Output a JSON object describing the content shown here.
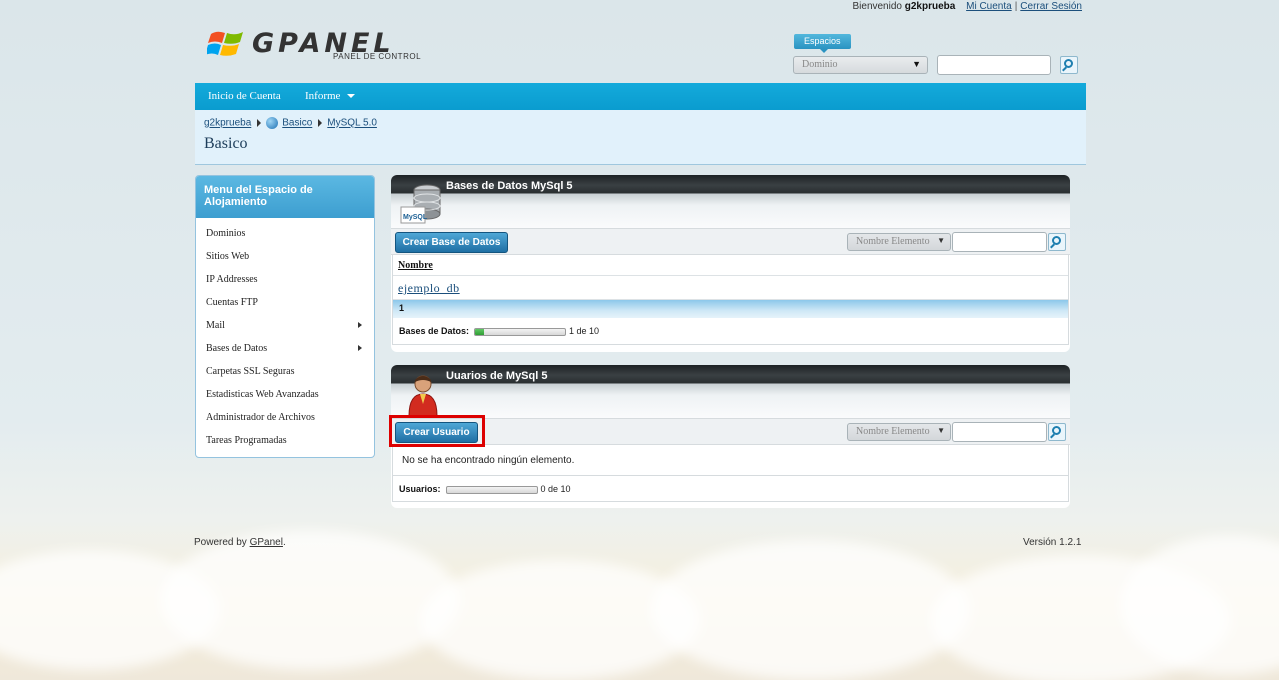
{
  "header": {
    "welcome_prefix": "Bienvenido",
    "username": "g2kprueba",
    "account_link": "Mi Cuenta",
    "separator": "|",
    "logout_link": "Cerrar Sesión"
  },
  "logo": {
    "word": "GPANEL",
    "subtitle": "PANEL DE CONTROL"
  },
  "spaces": {
    "tab_label": "Espacios",
    "domain_select_value": "Dominio",
    "search_value": ""
  },
  "nav": {
    "items": [
      {
        "label": "Inicio de Cuenta"
      },
      {
        "label": "Informe"
      }
    ]
  },
  "breadcrumb": {
    "items": [
      "g2kprueba",
      "Basico",
      "MySQL 5.0"
    ]
  },
  "page_title": "Basico",
  "sidebar": {
    "title": "Menu del Espacio de Alojamiento",
    "items": [
      {
        "label": "Dominios"
      },
      {
        "label": "Sitios Web"
      },
      {
        "label": "IP Addresses"
      },
      {
        "label": "Cuentas FTP"
      },
      {
        "label": "Mail"
      },
      {
        "label": "Bases de Datos"
      },
      {
        "label": "Carpetas SSL Seguras"
      },
      {
        "label": "Estadisticas Web Avanzadas"
      },
      {
        "label": "Administrador de Archivos"
      },
      {
        "label": "Tareas Programadas"
      }
    ]
  },
  "databases_panel": {
    "title": "Bases de Datos MySql 5",
    "icon_text": "MySQL",
    "create_button": "Crear Base de Datos",
    "filter_select": "Nombre Elemento",
    "filter_value": "",
    "column_header": "Nombre",
    "rows": [
      "ejemplo_db"
    ],
    "pager": "1",
    "quota_label": "Bases de Datos:",
    "quota_text": "1 de 10",
    "quota_fraction": 0.1
  },
  "users_panel": {
    "title": "Uuarios de MySql 5",
    "create_button": "Crear Usuario",
    "filter_select": "Nombre Elemento",
    "filter_value": "",
    "empty_message": "No se ha encontrado ningún elemento.",
    "quota_label": "Usuarios:",
    "quota_text": "0 de 10",
    "quota_fraction": 0
  },
  "footer": {
    "powered_prefix": "Powered by",
    "powered_link": "GPanel",
    "powered_suffix": ".",
    "version": "Versión 1.2.1"
  },
  "colors": {
    "nav_blue": "#0a9ccf",
    "button_blue": "#1f6fa4",
    "highlight_red": "#dd0000"
  }
}
